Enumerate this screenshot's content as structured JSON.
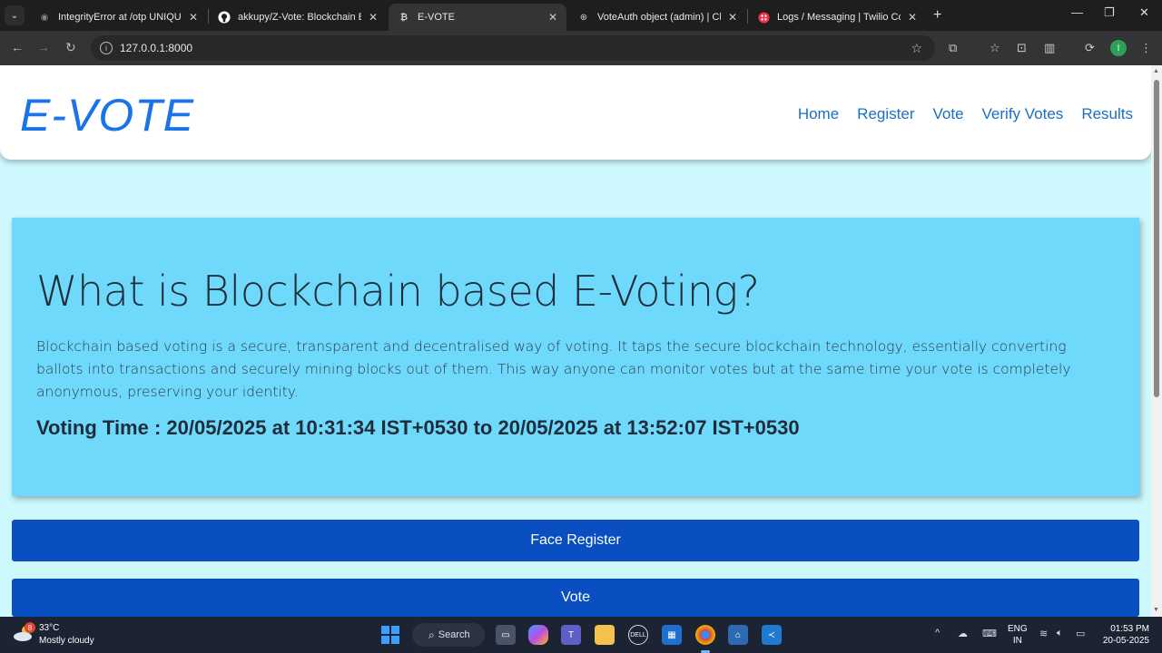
{
  "browser": {
    "tabs": [
      {
        "title": "IntegrityError at /otp UNIQUE c",
        "icon": "django-icon"
      },
      {
        "title": "akkupy/Z-Vote: Blockchain Base",
        "icon": "github-icon"
      },
      {
        "title": "E-VOTE",
        "icon": "bitcoin-icon",
        "active": true
      },
      {
        "title": "VoteAuth object (admin) | Chan",
        "icon": "globe-icon"
      },
      {
        "title": "Logs / Messaging | Twilio Conso",
        "icon": "twilio-icon"
      }
    ],
    "url": "127.0.0.1:8000",
    "profile_initial": "I"
  },
  "site": {
    "logo": "E-VOTE",
    "nav": [
      "Home",
      "Register",
      "Vote",
      "Verify Votes",
      "Results"
    ]
  },
  "hero": {
    "heading": "What is Blockchain based E-Voting?",
    "description": "Blockchain based voting is a secure, transparent and decentralised way of voting. It taps the secure blockchain technology, essentially converting ballots into transactions and securely mining blocks out of them. This way anyone can monitor votes but at the same time your vote is completely anonymous, preserving your identity.",
    "voting_time": "Voting Time : 20/05/2025 at 10:31:34 IST+0530 to 20/05/2025 at 13:52:07 IST+0530"
  },
  "buttons": {
    "face_register": "Face Register",
    "vote": "Vote"
  },
  "taskbar": {
    "weather_badge": "8",
    "temperature": "33°C",
    "weather": "Mostly cloudy",
    "search": "Search",
    "lang_line1": "ENG",
    "lang_line2": "IN",
    "time": "01:53 PM",
    "date": "20-05-2025"
  },
  "colors": {
    "page_bg": "#cdf8fd",
    "hero_bg": "#6fd9fc",
    "button_bg": "#0a4fc1",
    "logo": "#1a73e8",
    "nav_link": "#1a6fc2"
  }
}
